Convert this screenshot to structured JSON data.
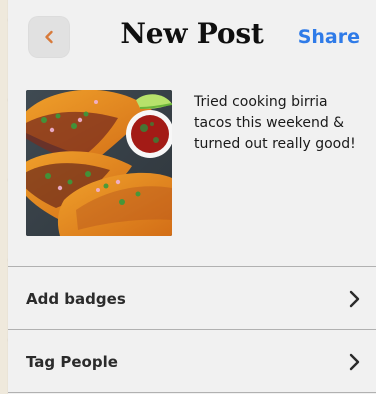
{
  "header": {
    "title": "New Post",
    "share_label": "Share"
  },
  "post": {
    "caption": "Tried cooking birria tacos this weekend & turned out really good!"
  },
  "options": [
    {
      "label": "Add badges"
    },
    {
      "label": "Tag People"
    }
  ],
  "colors": {
    "accent": "#2f7be8",
    "back_chevron": "#d87a3a",
    "panel_bg": "#f1f1f1",
    "page_bg": "#efe9dc"
  }
}
